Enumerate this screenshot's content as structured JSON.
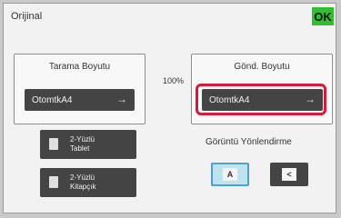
{
  "header": {
    "title": "Orijinal",
    "ok_label": "OK"
  },
  "scan_size": {
    "label": "Tarama Boyutu",
    "value": "OtomtkA4"
  },
  "ratio": "100%",
  "send_size": {
    "label": "Gönd. Boyutu",
    "value": "OtomtkA4"
  },
  "duplex_tablet": {
    "line1": "2-Yüzlü",
    "line2": "Tablet"
  },
  "duplex_booklet": {
    "line1": "2-Yüzlü",
    "line2": "Kitapçık"
  },
  "orientation": {
    "label": "Görüntü Yönlendirme",
    "portrait_glyph": "A",
    "landscape_glyph": "<"
  },
  "colors": {
    "ok_green": "#2fbf2f",
    "highlight_red": "#d8193a",
    "selected_blue": "#bfe2f0"
  }
}
